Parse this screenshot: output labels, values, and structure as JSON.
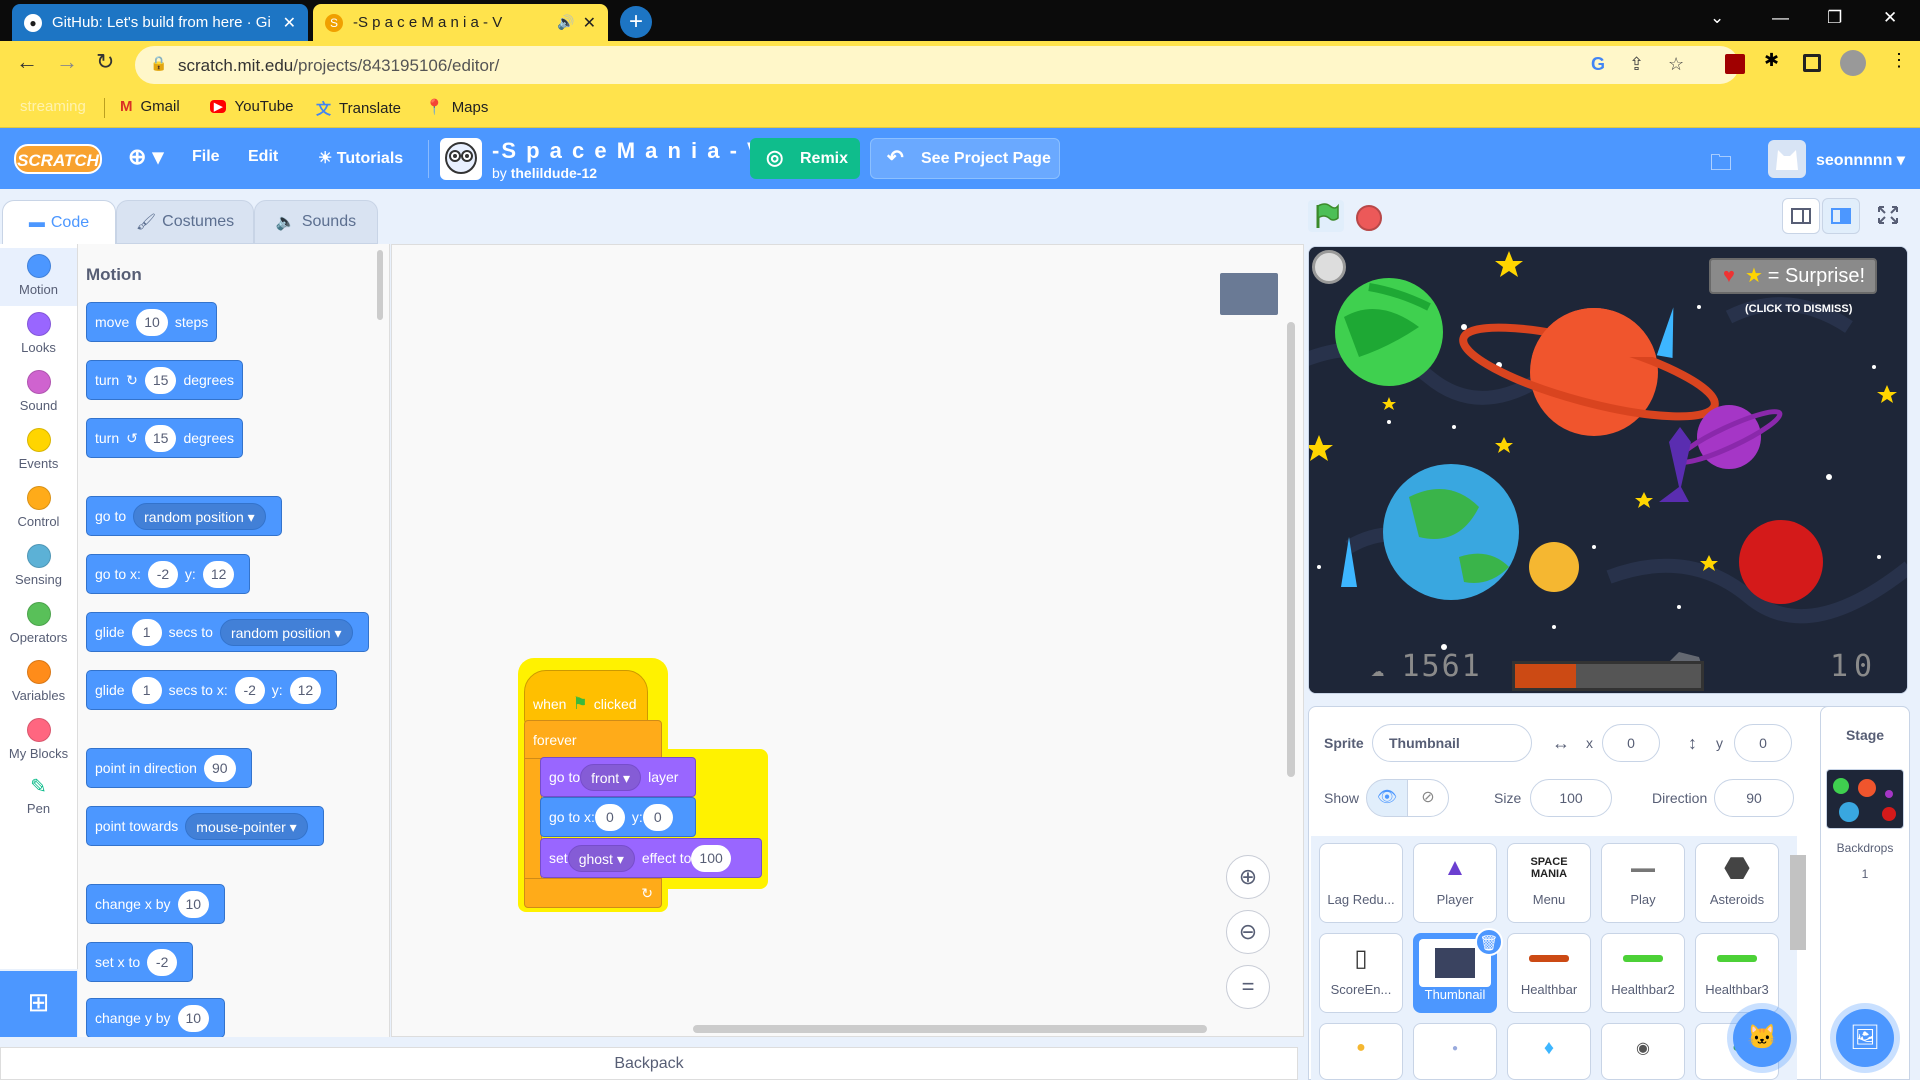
{
  "browser": {
    "tabs": [
      {
        "title": "GitHub: Let's build from here · Gi",
        "close": "✕"
      },
      {
        "title": "-S p a c e M a n i a - V",
        "close": "✕"
      }
    ],
    "new_tab": "+",
    "url_host": "scratch.mit.edu",
    "url_path": "/projects/843195106/editor/",
    "bookmarks": [
      {
        "label": "streaming"
      },
      {
        "label": "Gmail"
      },
      {
        "label": "YouTube"
      },
      {
        "label": "Translate"
      },
      {
        "label": "Maps"
      }
    ]
  },
  "menubar": {
    "logo": "SCRATCH",
    "file": "File",
    "edit": "Edit",
    "tutorials": "Tutorials",
    "project_title": "-S p a c e M a n i a - V...",
    "by_prefix": "by",
    "author": "thelildude-12",
    "remix": "Remix",
    "see_project": "See Project Page",
    "username": "seonnnnn"
  },
  "editor_tabs": {
    "code": "Code",
    "costumes": "Costumes",
    "sounds": "Sounds"
  },
  "categories": [
    {
      "label": "Motion",
      "color": "#4c97ff"
    },
    {
      "label": "Looks",
      "color": "#9966ff"
    },
    {
      "label": "Sound",
      "color": "#cf63cf"
    },
    {
      "label": "Events",
      "color": "#ffd500"
    },
    {
      "label": "Control",
      "color": "#ffab19"
    },
    {
      "label": "Sensing",
      "color": "#5cb1d6"
    },
    {
      "label": "Operators",
      "color": "#59c059"
    },
    {
      "label": "Variables",
      "color": "#ff8c1a"
    },
    {
      "label": "My Blocks",
      "color": "#ff6680"
    },
    {
      "label": "Pen",
      "color": "#0fbd8c"
    }
  ],
  "palette": {
    "heading": "Motion",
    "move": {
      "a": "move",
      "v": "10",
      "b": "steps"
    },
    "turn_cw": {
      "a": "turn",
      "v": "15",
      "b": "degrees"
    },
    "turn_ccw": {
      "a": "turn",
      "v": "15",
      "b": "degrees"
    },
    "goto": {
      "a": "go to",
      "d": "random position"
    },
    "gotoxy": {
      "a": "go to x:",
      "x": "-2",
      "b": "y:",
      "y": "12"
    },
    "glide_to": {
      "a": "glide",
      "v": "1",
      "b": "secs to",
      "d": "random position"
    },
    "glide_xy": {
      "a": "glide",
      "v": "1",
      "b": "secs to x:",
      "x": "-2",
      "c": "y:",
      "y": "12"
    },
    "point_dir": {
      "a": "point in direction",
      "v": "90"
    },
    "point_towards": {
      "a": "point towards",
      "d": "mouse-pointer"
    },
    "change_x": {
      "a": "change x by",
      "v": "10"
    },
    "set_x": {
      "a": "set x to",
      "v": "-2"
    },
    "change_y": {
      "a": "change y by",
      "v": "10"
    }
  },
  "script": {
    "hat": {
      "a": "when",
      "b": "clicked"
    },
    "forever": "forever",
    "layer": {
      "a": "go to",
      "d": "front",
      "b": "layer"
    },
    "gotoxy": {
      "a": "go to x:",
      "x": "0",
      "b": "y:",
      "y": "0"
    },
    "effect": {
      "a": "set",
      "d": "ghost",
      "b": "effect to",
      "v": "100"
    }
  },
  "backpack": "Backpack",
  "stage": {
    "surprise_text": "= Surprise!",
    "dismiss": "(CLICK TO DISMISS)",
    "score": "1561",
    "lives": "10",
    "health_fill_percent": 33
  },
  "sprite_info": {
    "sprite_label": "Sprite",
    "name": "Thumbnail",
    "x_label": "x",
    "x": "0",
    "y_label": "y",
    "y": "0",
    "show_label": "Show",
    "size_label": "Size",
    "size": "100",
    "direction_label": "Direction",
    "direction": "90"
  },
  "sprites": [
    {
      "name": "Lag Redu..."
    },
    {
      "name": "Player"
    },
    {
      "name": "Menu"
    },
    {
      "name": "Play"
    },
    {
      "name": "Asteroids"
    },
    {
      "name": "ScoreEn..."
    },
    {
      "name": "Thumbnail"
    },
    {
      "name": "Healthbar"
    },
    {
      "name": "Healthbar2"
    },
    {
      "name": "Healthbar3"
    }
  ],
  "stage_pane": {
    "title": "Stage",
    "backdrops_label": "Backdrops",
    "backdrops_count": "1"
  }
}
